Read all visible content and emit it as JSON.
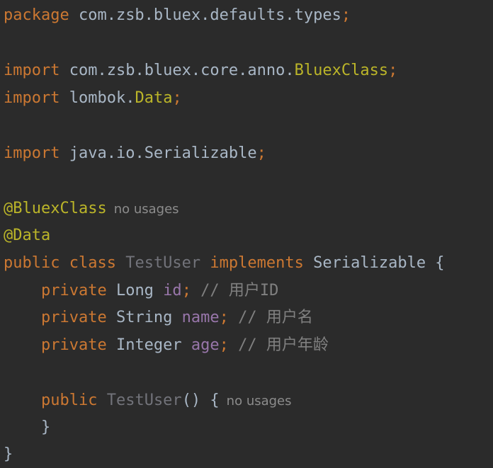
{
  "editor": {
    "language": "java",
    "theme_colors": {
      "background": "#2b2b2b",
      "keyword": "#cc7832",
      "annotation": "#bbb529",
      "field": "#9876aa",
      "comment": "#808080",
      "plain": "#a9b7c6",
      "unused": "#72737a"
    },
    "tokens": {
      "package_kw": "package",
      "package_name": " com.zsb.bluex.defaults.types",
      "semicolon": ";",
      "import_kw": "import",
      "import1_path": " com.zsb.bluex.core.anno.",
      "import1_class": "BluexClass",
      "import2_path": " lombok.",
      "import2_class": "Data",
      "import3_path": " java.io.Serializable",
      "ann_bluex": "@BluexClass",
      "ann_data": "@Data",
      "public_kw": "public",
      "class_kw": " class ",
      "class_name": "TestUser",
      "implements_kw": " implements ",
      "interface_name": "Serializable {",
      "private_kw": "private",
      "type_long": " Long ",
      "field_id": "id",
      "comment_id": " // 用户ID",
      "type_string": " String ",
      "field_name": "name",
      "comment_name": " // 用户名",
      "type_integer": " Integer ",
      "field_age": "age",
      "comment_age": " // 用户年龄",
      "ctor_name": " TestUser",
      "ctor_rest": "() {",
      "close_brace_inner": "}",
      "close_brace_outer": "}"
    },
    "inlay_hints": {
      "class_usages": "no usages",
      "ctor_usages": "no usages"
    }
  }
}
